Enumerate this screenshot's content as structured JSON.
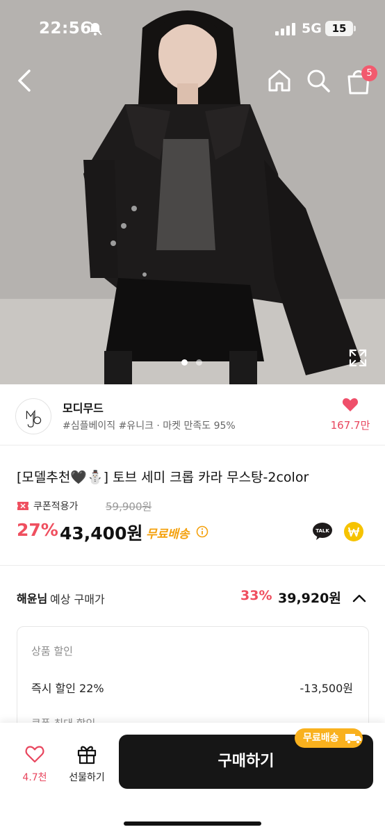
{
  "status_bar": {
    "time": "22:56",
    "network": "5G",
    "battery": "15"
  },
  "header": {
    "back_icon": "chevron-left-icon",
    "home_icon": "home-icon",
    "search_icon": "search-icon",
    "cart_icon": "shopping-bag-icon",
    "cart_badge": "5"
  },
  "gallery": {
    "slide_count": 2,
    "active_slide": 1
  },
  "shop": {
    "name": "모디무드",
    "tags": "#심플베이직 #유니크 · 마켓 만족도 95%",
    "likes": "167.7만"
  },
  "product": {
    "title": "[모델추천🖤⛄] 토브 세미 크롭 카라 무스탕-2color",
    "coupon_label": "쿠폰적용가",
    "original_price": "59,900원",
    "discount_rate": "27%",
    "sale_price": "43,400원",
    "free_shipping": "무료배송"
  },
  "member_price": {
    "name": "해윤님",
    "label": "예상 구매가",
    "rate": "33%",
    "price": "39,920원"
  },
  "discount_box": {
    "header": "상품 할인",
    "line_label": "즉시 할인 22%",
    "line_value": "-13,500원",
    "next_label": "쿠폰 최대 할인"
  },
  "bottom_bar": {
    "wish_count": "4.7천",
    "gift_label": "선물하기",
    "buy_label": "구매하기",
    "ship_pill": "무료배송"
  },
  "colors": {
    "accent_red": "#ef4f5f",
    "ship_orange": "#f4a10d",
    "buy_button": "#161616"
  }
}
